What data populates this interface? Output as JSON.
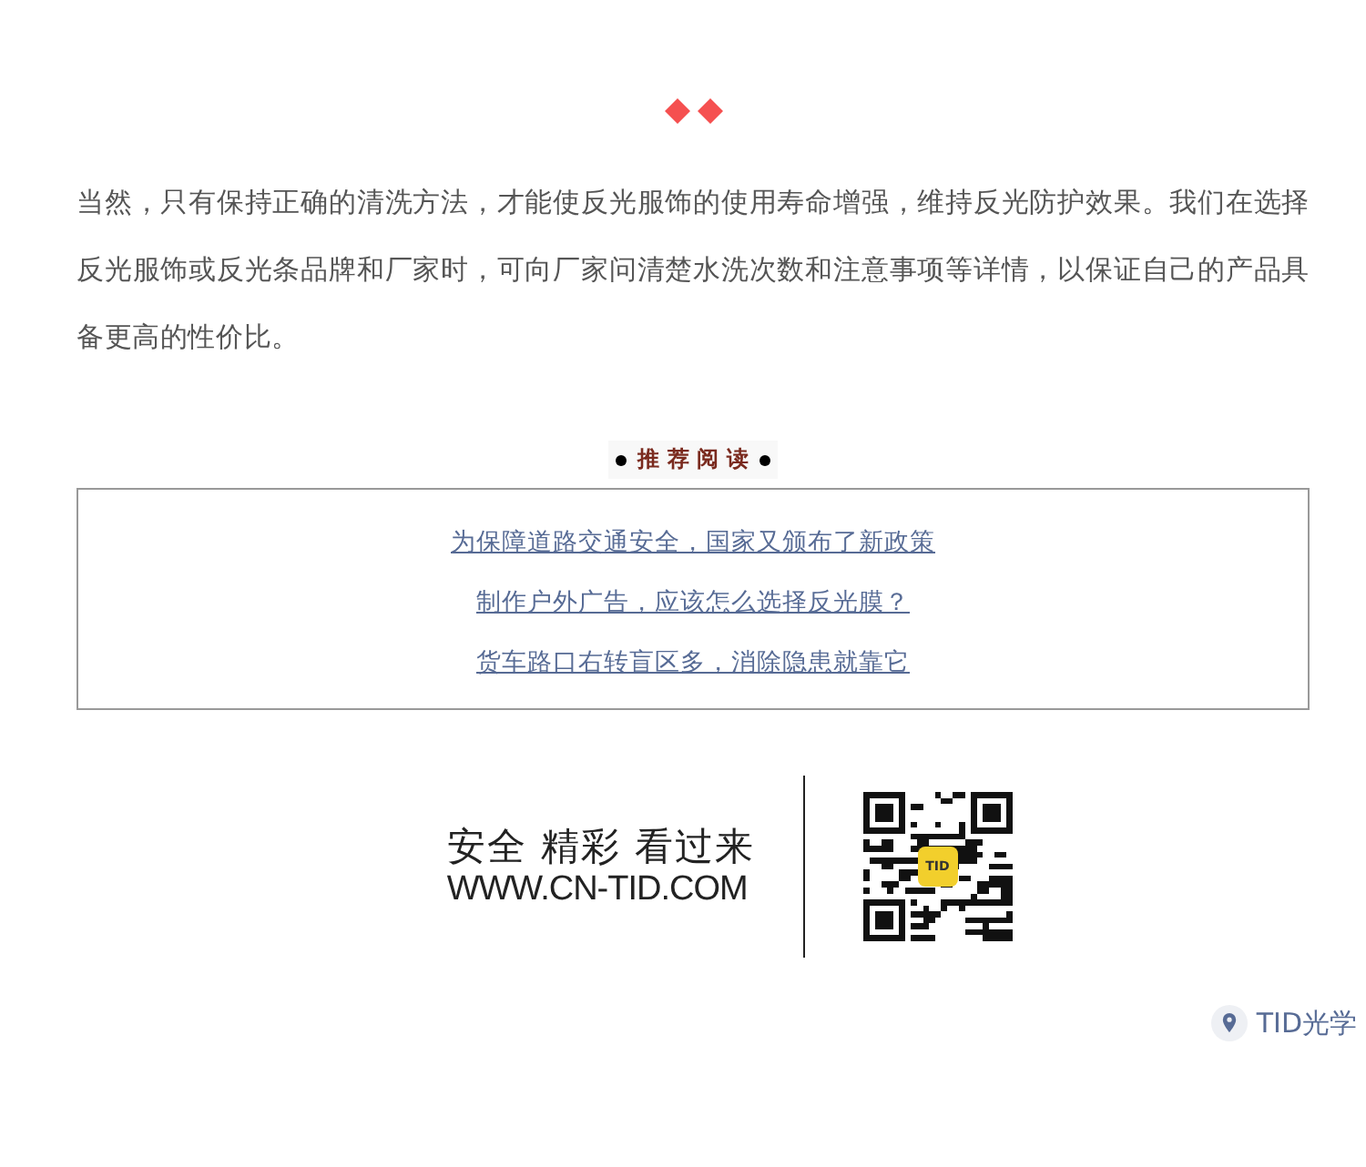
{
  "paragraph": "当然，只有保持正确的清洗方法，才能使反光服饰的使用寿命增强，维持反光防护效果。我们在选择反光服饰或反光条品牌和厂家时，可向厂家问清楚水洗次数和注意事项等详情，以保证自己的产品具备更高的性价比。",
  "recommend": {
    "title": "推 荐 阅 读",
    "links": [
      "为保障道路交通安全，国家又颁布了新政策",
      "制作户外广告，应该怎么选择反光膜？",
      "货车路口右转盲区多，消除隐患就靠它"
    ]
  },
  "banner": {
    "slogan": "安全 精彩 看过来",
    "url": "WWW.CN-TID.COM",
    "qr_logo": "TID"
  },
  "location": {
    "label": "TID光学"
  }
}
